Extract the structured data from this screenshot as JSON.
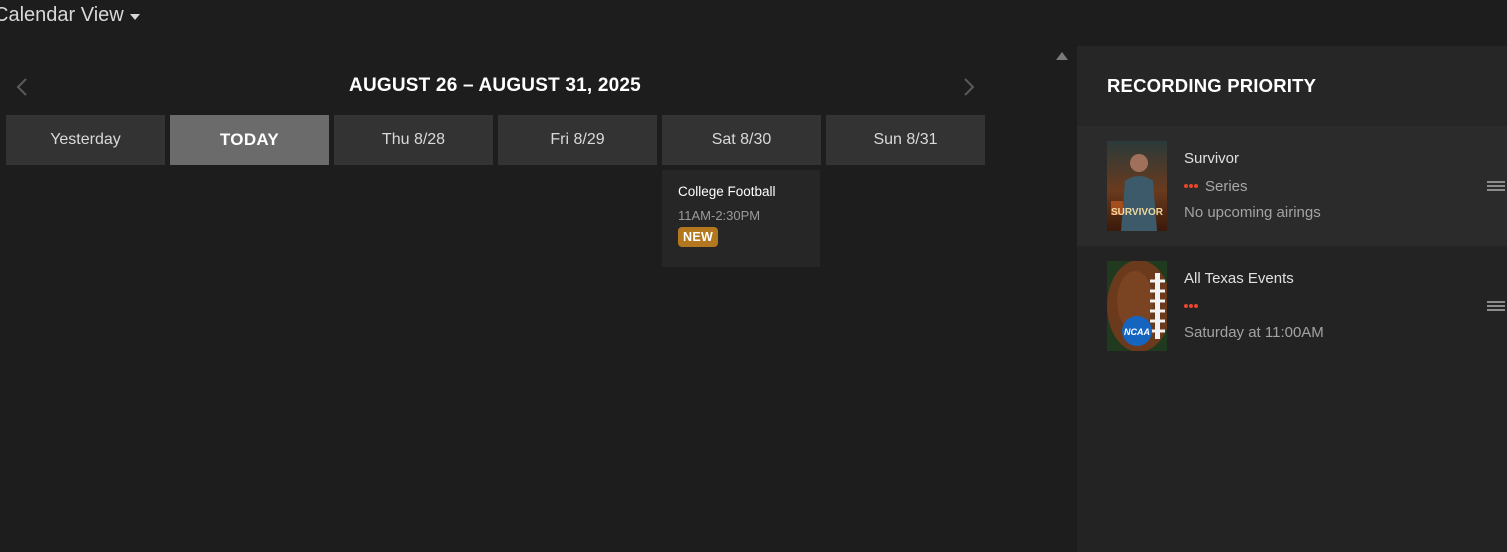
{
  "view_selector": {
    "label": "Calendar View"
  },
  "calendar": {
    "week_title": "AUGUST 26 – AUGUST 31, 2025",
    "days": [
      {
        "label": "Yesterday"
      },
      {
        "label": "TODAY"
      },
      {
        "label": "Thu 8/28"
      },
      {
        "label": "Fri 8/29"
      },
      {
        "label": "Sat 8/30"
      },
      {
        "label": "Sun 8/31"
      }
    ],
    "event": {
      "title": "College Football",
      "time": "11AM-2:30PM",
      "badge": "NEW"
    }
  },
  "recording_priority": {
    "title": "RECORDING PRIORITY",
    "items": [
      {
        "name": "Survivor",
        "type": "Series",
        "status": "No upcoming airings",
        "thumb_text": "SURVIVOR"
      },
      {
        "name": "All Texas Events",
        "type": "",
        "status": "Saturday at 11:00AM",
        "thumb_text": "NCAA"
      }
    ]
  },
  "colors": {
    "background": "#1d1d1d",
    "tab": "#333333",
    "tab_active": "#6b6b6b",
    "badge_new": "#b3781f",
    "record_icon": "#e8472b"
  },
  "icons": {
    "view_dropdown": "caret-down-icon",
    "prev": "chevron-left-icon",
    "next": "chevron-right-icon",
    "scroll": "scroll-up-icon",
    "recording": "recording-dots-icon",
    "reorder": "drag-handle-icon"
  }
}
